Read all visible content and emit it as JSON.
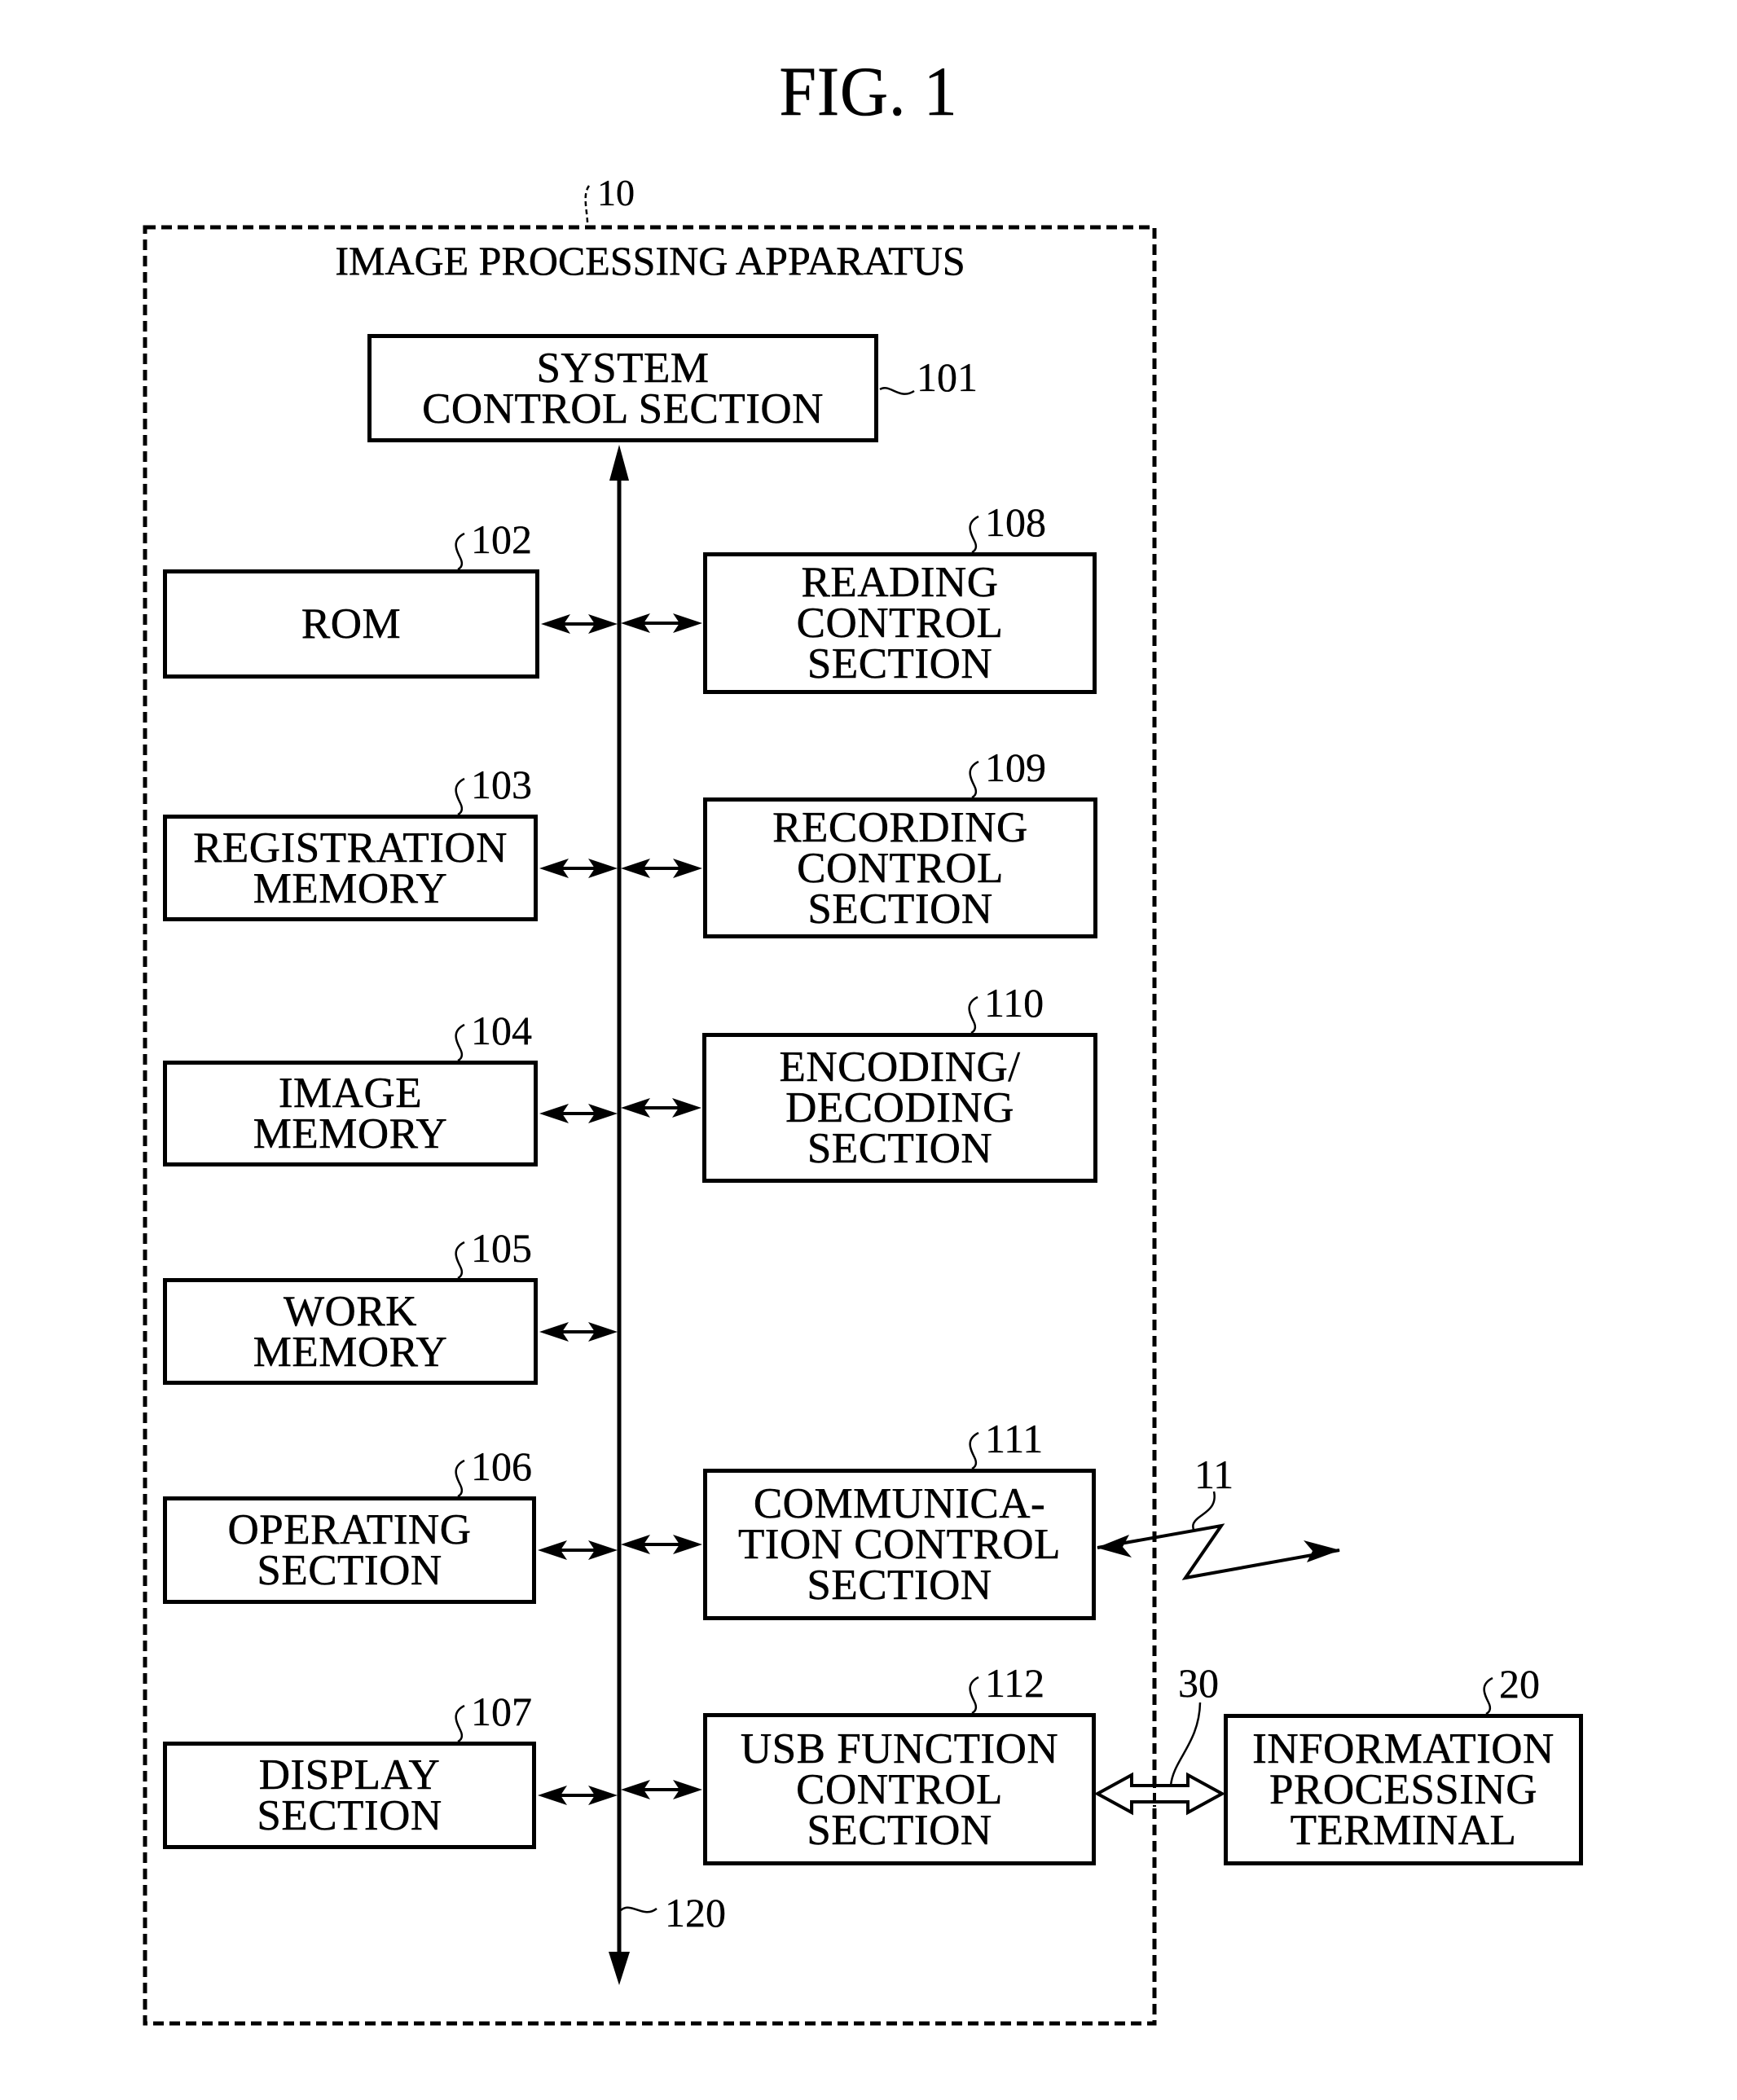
{
  "figure": {
    "title": "FIG. 1",
    "apparatus": {
      "ref": "10",
      "title": "IMAGE PROCESSING APPARATUS"
    },
    "bus": {
      "ref": "120"
    },
    "blocks": [
      {
        "id": "system-control",
        "ref": "101",
        "lines": [
          "SYSTEM",
          "CONTROL SECTION"
        ]
      },
      {
        "id": "rom",
        "ref": "102",
        "lines": [
          "ROM"
        ]
      },
      {
        "id": "registration-memory",
        "ref": "103",
        "lines": [
          "REGISTRATION",
          "MEMORY"
        ]
      },
      {
        "id": "image-memory",
        "ref": "104",
        "lines": [
          "IMAGE",
          "MEMORY"
        ]
      },
      {
        "id": "work-memory",
        "ref": "105",
        "lines": [
          "WORK",
          "MEMORY"
        ]
      },
      {
        "id": "operating-section",
        "ref": "106",
        "lines": [
          "OPERATING",
          "SECTION"
        ]
      },
      {
        "id": "display-section",
        "ref": "107",
        "lines": [
          "DISPLAY",
          "SECTION"
        ]
      },
      {
        "id": "reading-control",
        "ref": "108",
        "lines": [
          "READING",
          "CONTROL",
          "SECTION"
        ]
      },
      {
        "id": "recording-control",
        "ref": "109",
        "lines": [
          "RECORDING",
          "CONTROL",
          "SECTION"
        ]
      },
      {
        "id": "encoding-decoding",
        "ref": "110",
        "lines": [
          "ENCODING/",
          "DECODING",
          "SECTION"
        ]
      },
      {
        "id": "communication-control",
        "ref": "111",
        "lines": [
          "COMMUNICA-",
          "TION CONTROL",
          "SECTION"
        ]
      },
      {
        "id": "usb-function-control",
        "ref": "112",
        "lines": [
          "USB FUNCTION",
          "CONTROL",
          "SECTION"
        ]
      },
      {
        "id": "information-processing-terminal",
        "ref": "20",
        "lines": [
          "INFORMATION",
          "PROCESSING",
          "TERMINAL"
        ]
      }
    ],
    "wireless_link": {
      "ref": "11"
    },
    "usb_link": {
      "ref": "30"
    }
  }
}
